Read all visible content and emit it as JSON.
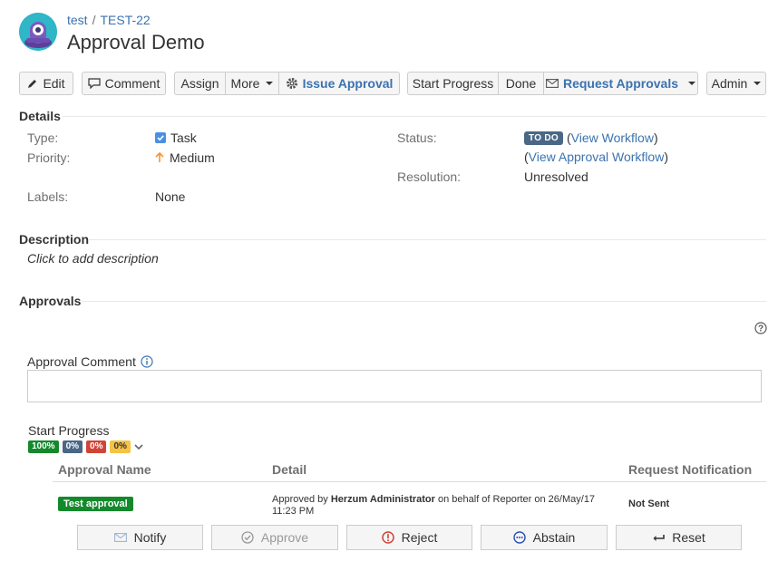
{
  "header": {
    "project": "test",
    "separator": "/",
    "issue_key": "TEST-22",
    "title": "Approval Demo"
  },
  "toolbar": {
    "edit": "Edit",
    "comment": "Comment",
    "assign": "Assign",
    "more": "More",
    "issue_approval": "Issue Approval",
    "start_progress": "Start Progress",
    "done": "Done",
    "request_approvals": "Request Approvals",
    "admin": "Admin"
  },
  "details": {
    "heading": "Details",
    "type_label": "Type:",
    "type_value": "Task",
    "priority_label": "Priority:",
    "priority_value": "Medium",
    "labels_label": "Labels:",
    "labels_value": "None",
    "status_label": "Status:",
    "status_value": "TO DO",
    "view_workflow": "View Workflow",
    "view_approval_workflow": "View Approval Workflow",
    "resolution_label": "Resolution:",
    "resolution_value": "Unresolved"
  },
  "description": {
    "heading": "Description",
    "placeholder": "Click to add description"
  },
  "approvals": {
    "heading": "Approvals",
    "comment_label": "Approval Comment",
    "stage": "Start Progress",
    "percentages": [
      {
        "text": "100%",
        "color": "#14892c"
      },
      {
        "text": "0%",
        "color": "#4a6785"
      },
      {
        "text": "0%",
        "color": "#d04437"
      },
      {
        "text": "0%",
        "color": "#f6c342"
      }
    ],
    "columns": [
      "Approval Name",
      "Detail",
      "Request Notification"
    ],
    "rows": [
      {
        "name": "Test approval",
        "detail_prefix": "Approved by ",
        "detail_user": "Herzum Administrator",
        "detail_suffix": " on behalf of Reporter on 26/May/17",
        "detail_time": "11:23 PM",
        "notification": "Not Sent"
      }
    ],
    "actions": {
      "notify": "Notify",
      "approve": "Approve",
      "reject": "Reject",
      "abstain": "Abstain",
      "reset": "Reset"
    }
  },
  "colors": {
    "link": "#3b73af",
    "status_lozenge": "#4a6785",
    "approved_tag": "#14892c",
    "reject_icon": "#d04437",
    "abstain_icon": "#2d4fb3",
    "priority_arrow": "#f79232",
    "checkbox": "#4a90e2"
  }
}
